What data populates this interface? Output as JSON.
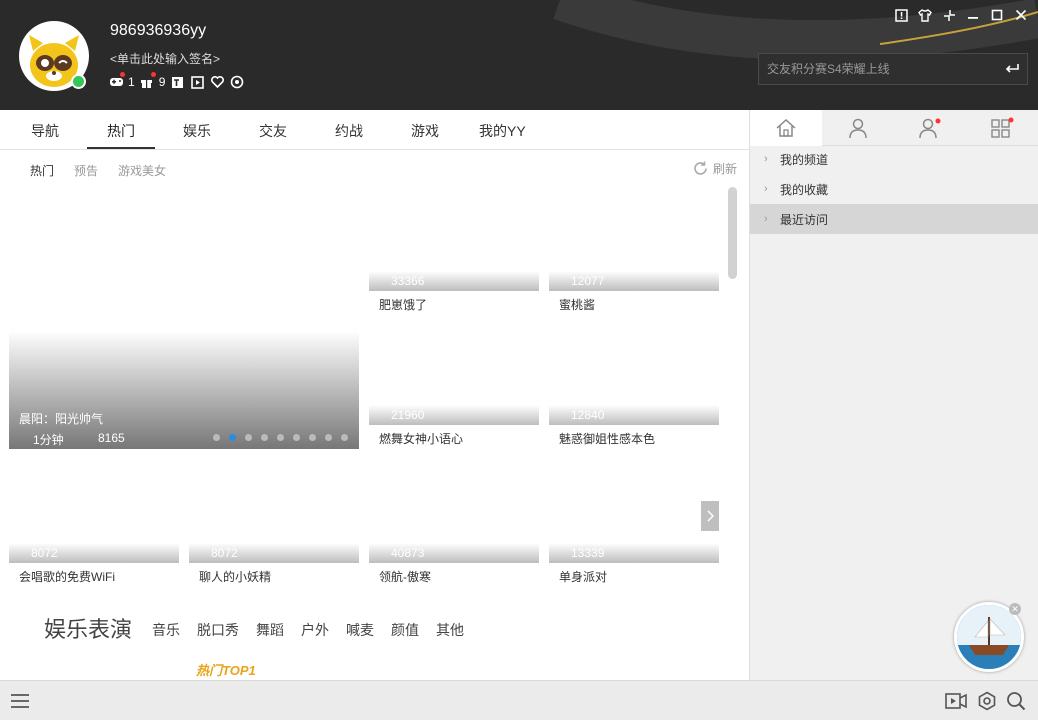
{
  "user": {
    "name": "986936936yy",
    "signature": "<单击此处输入签名>",
    "badge_count_1": "1",
    "badge_count_2": "9"
  },
  "search": {
    "placeholder": "交友积分赛S4荣耀上线"
  },
  "tabs": [
    "导航",
    "热门",
    "娱乐",
    "交友",
    "约战",
    "游戏",
    "我的YY"
  ],
  "active_tab": "热门",
  "subtabs": [
    "热门",
    "预告",
    "游戏美女"
  ],
  "refresh_label": "刷新",
  "featured": {
    "title": "晨阳：阳光帅气",
    "time": "1分钟",
    "count": "8165",
    "slides": 9,
    "active_slide": 2
  },
  "grid": [
    {
      "count": "33366",
      "caption": "肥崽饿了"
    },
    {
      "count": "12077",
      "caption": "蜜桃酱"
    },
    {
      "count": "21960",
      "caption": "燃舞女神小语心"
    },
    {
      "count": "12840",
      "caption": "魅惑御姐性感本色"
    },
    {
      "count": "8072",
      "caption": "会唱歌的免费WiFi"
    },
    {
      "count": "8072",
      "caption": "聊人的小妖精"
    },
    {
      "count": "40873",
      "caption": "领航-傲寒"
    },
    {
      "count": "13339",
      "caption": "单身派对"
    }
  ],
  "section": {
    "title": "娱乐表演",
    "categories": [
      "音乐",
      "脱口秀",
      "舞蹈",
      "户外",
      "喊麦",
      "颜值",
      "其他"
    ],
    "hot_badge": "热门TOP1"
  },
  "right_panel": {
    "items": [
      "我的频道",
      "我的收藏",
      "最近访问"
    ],
    "selected": "最近访问"
  },
  "colors": {
    "accent": "#2a8ee0",
    "header_bg": "#2a2a2a",
    "notify": "#ff3333",
    "hot": "#e8a41a"
  }
}
